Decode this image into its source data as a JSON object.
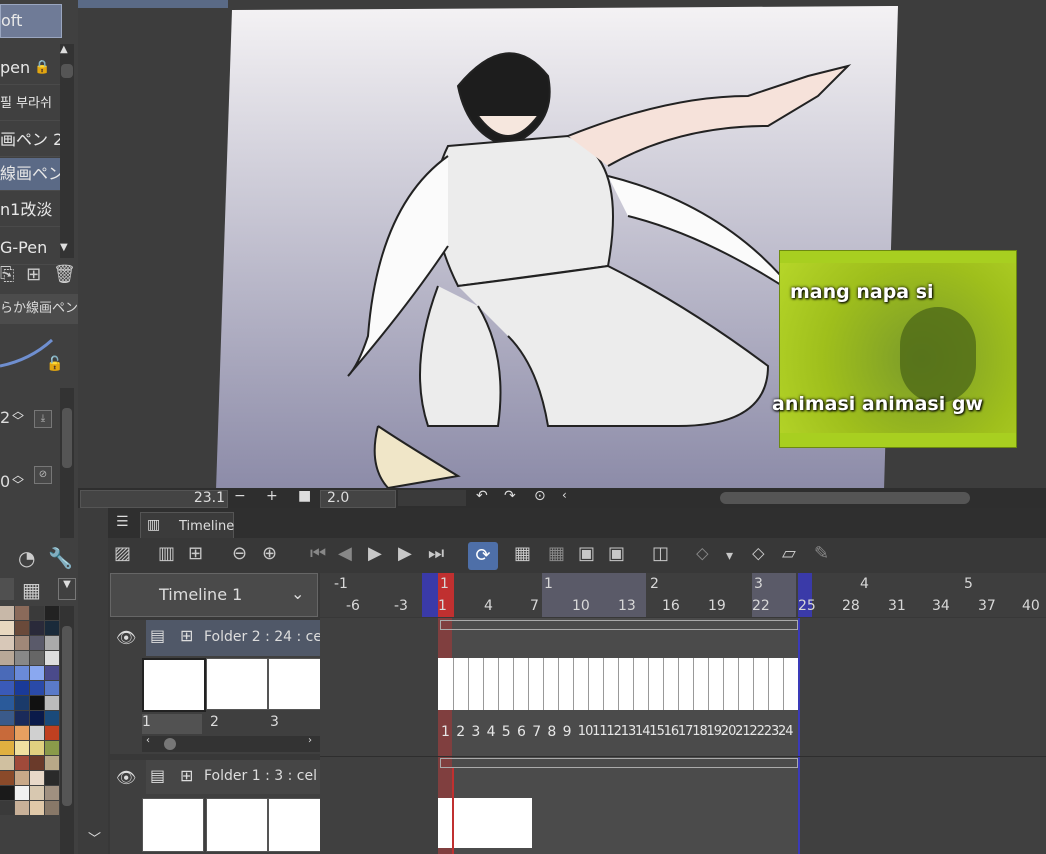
{
  "brushes": [
    {
      "label": "oft",
      "selected": true
    },
    {
      "label": "pen",
      "locked": true
    },
    {
      "label": "필 부라쉬"
    },
    {
      "label": "画ペン 2"
    },
    {
      "label": "線画ペン",
      "selected": true
    },
    {
      "label": "n1改淡"
    },
    {
      "label": "G-Pen"
    }
  ],
  "subtool_name": "らか線画ペン",
  "brush_size_value": "2",
  "opacity_value": "0",
  "canvas": {
    "meme_text_top": "mang napa si",
    "meme_text_bottom": "animasi animasi gw"
  },
  "status": {
    "zoom": "23.1",
    "minus": "−",
    "plus": "+",
    "angle": "2.0"
  },
  "timeline": {
    "tab_label": "Timeline",
    "timeline_name": "Timeline 1",
    "ruler_top": [
      "-1",
      "1",
      "1",
      "2",
      "3",
      "4",
      "5"
    ],
    "ruler_bottom": [
      "-6",
      "-3",
      "1",
      "4",
      "7",
      "10",
      "13",
      "16",
      "19",
      "22",
      "25",
      "28",
      "31",
      "34",
      "37",
      "40"
    ],
    "folder2_label": "Folder 2 : 24 : cel",
    "folder1_label": "Folder 1 : 3 : cel",
    "folder2_thumbs": [
      "1",
      "2",
      "3"
    ],
    "frame_numbers": [
      "1",
      "2",
      "3",
      "4",
      "5",
      "6",
      "7",
      "8",
      "9",
      "10",
      "11",
      "12",
      "13",
      "14",
      "15",
      "16",
      "17",
      "18",
      "19",
      "20",
      "21",
      "22",
      "23",
      "24"
    ]
  },
  "colors": {
    "accent": "#4e6fa8",
    "playhead": "#c03030",
    "end_marker": "#3a3ab8"
  }
}
